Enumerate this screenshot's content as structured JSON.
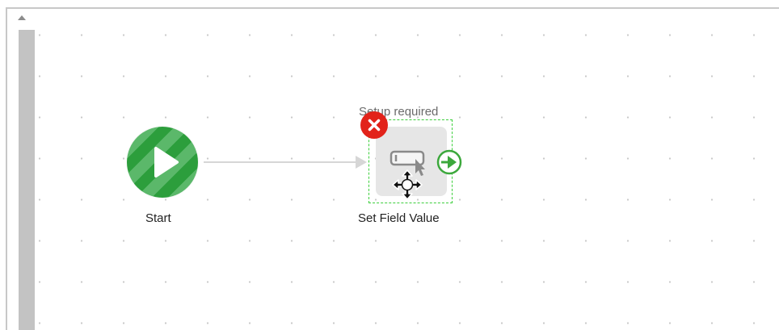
{
  "canvas": {
    "start_node": {
      "label": "Start",
      "icon": "play-icon",
      "color": "#2c9e3c"
    },
    "task_node": {
      "label": "Set Field Value",
      "status": "Setup required",
      "icon": "set-field-value-icon",
      "error_icon": "close-icon",
      "port_icon": "arrow-right-circle-icon",
      "error_color": "#e2231a",
      "selection_color": "#3ccf3c"
    },
    "cursor": "move-cursor-icon"
  },
  "scrollbar": {
    "up_icon": "scroll-up-icon"
  }
}
